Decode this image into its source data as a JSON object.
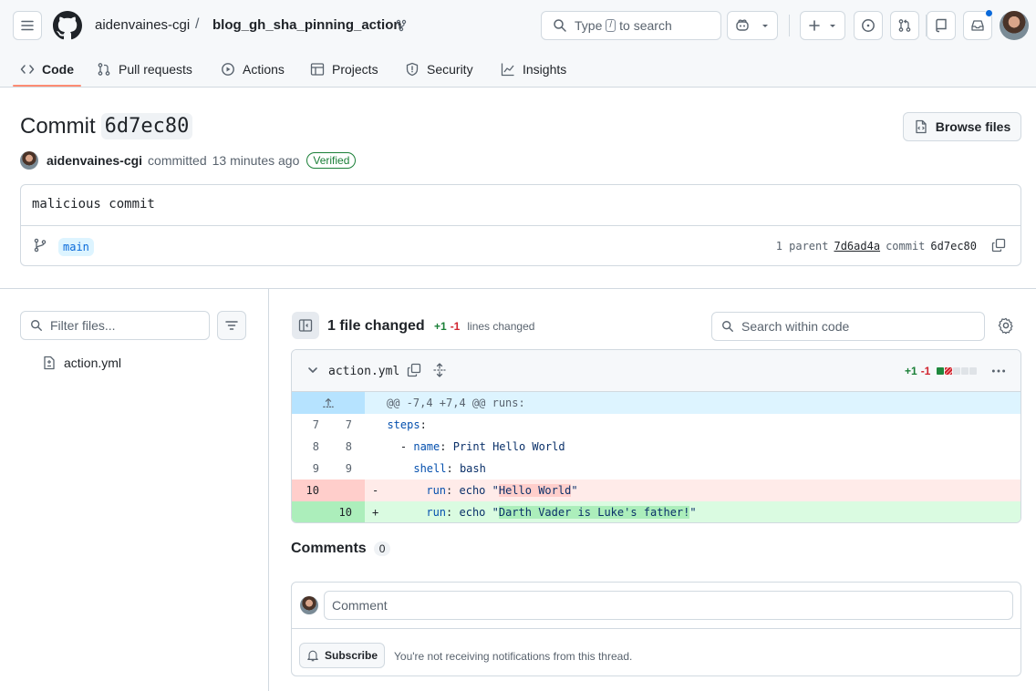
{
  "header": {
    "owner": "aidenvaines-cgi",
    "separator": "/",
    "repo": "blog_gh_sha_pinning_action",
    "search_pre": "Type",
    "search_key": "/",
    "search_post": "to search"
  },
  "tabs": [
    {
      "label": "Code",
      "icon": "code-icon"
    },
    {
      "label": "Pull requests",
      "icon": "git-pull-request-icon"
    },
    {
      "label": "Actions",
      "icon": "play-icon"
    },
    {
      "label": "Projects",
      "icon": "table-icon"
    },
    {
      "label": "Security",
      "icon": "shield-icon"
    },
    {
      "label": "Insights",
      "icon": "graph-icon"
    }
  ],
  "commit": {
    "title_prefix": "Commit",
    "sha": "6d7ec80",
    "browse_label": "Browse files",
    "author": "aidenvaines-cgi",
    "action": "committed",
    "time": "13 minutes ago",
    "verified": "Verified",
    "message": "malicious commit",
    "branch": "main",
    "parent_label": "1 parent",
    "parent_sha": "7d6ad4a",
    "commit_label": "commit",
    "commit_sha": "6d7ec80"
  },
  "filetree": {
    "filter_placeholder": "Filter files...",
    "files": [
      "action.yml"
    ]
  },
  "summary": {
    "changed": "1 file changed",
    "additions": "+1",
    "deletions": "-1",
    "lines_changed": "lines changed",
    "code_search_placeholder": "Search within code"
  },
  "diff": {
    "filename": "action.yml",
    "additions": "+1",
    "deletions": "-1",
    "hunk_header": "@@ -7,4 +7,4 @@ runs:",
    "lines": [
      {
        "old": "7",
        "new": "7",
        "indent": "  ",
        "dash": "",
        "key": "steps",
        "rest": ""
      },
      {
        "old": "8",
        "new": "8",
        "indent": "    ",
        "dash": "- ",
        "key": "name",
        "rest": " Print Hello World"
      },
      {
        "old": "9",
        "new": "9",
        "indent": "      ",
        "dash": "",
        "key": "shell",
        "rest": " bash"
      },
      {
        "old": "10",
        "new": "",
        "sign": "-",
        "indent": "      ",
        "key": "run",
        "pre": " echo \"",
        "hl": "Hello World",
        "post": "\""
      },
      {
        "old": "",
        "new": "10",
        "sign": "+",
        "indent": "      ",
        "key": "run",
        "pre": " echo \"",
        "hl": "Darth Vader is Luke's father!",
        "post": "\""
      }
    ]
  },
  "comments": {
    "title": "Comments",
    "count": "0",
    "placeholder": "Comment",
    "subscribe": "Subscribe",
    "notice": "You're not receiving notifications from this thread."
  },
  "colors": {
    "accent": "#0969da",
    "addition": "#1a7f37",
    "deletion": "#d1242f",
    "tab_underline": "#fd8c73"
  }
}
